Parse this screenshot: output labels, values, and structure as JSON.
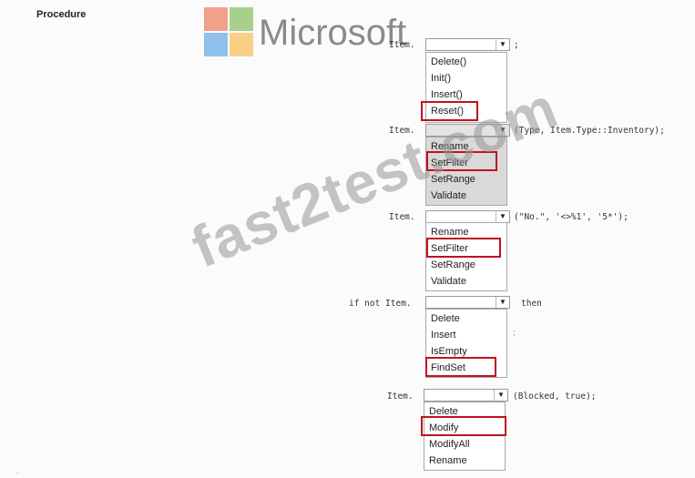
{
  "heading": "Procedure",
  "logo": {
    "text": "Microsoft",
    "colors": [
      "#f0a18c",
      "#a7d08c",
      "#8ec0ea",
      "#f8d186"
    ]
  },
  "watermark": "fast2test.com",
  "blocks": [
    {
      "prefix": "Item.",
      "suffix": ";",
      "options": [
        "Delete()",
        "Init()",
        "Insert()",
        "Reset()"
      ],
      "selected": "Reset()"
    },
    {
      "prefix": "Item.",
      "suffix": "(Type, Item.Type::Inventory);",
      "options": [
        "Rename",
        "SetFilter",
        "SetRange",
        "Validate"
      ],
      "selected": "SetFilter"
    },
    {
      "prefix": "Item.",
      "suffix": "(\"No.\", '<>%1', '5*');",
      "options": [
        "Rename",
        "SetFilter",
        "SetRange",
        "Validate"
      ],
      "selected": "SetFilter"
    },
    {
      "prefix": "if not Item.",
      "suffix": "then",
      "options": [
        "Delete",
        "Insert",
        "IsEmpty",
        "FindSet"
      ],
      "selected": "FindSet"
    },
    {
      "prefix": "Item.",
      "suffix": "(Blocked, true);",
      "options": [
        "Delete",
        "Modify",
        "ModifyAll",
        "Rename"
      ],
      "selected": "Modify"
    }
  ]
}
